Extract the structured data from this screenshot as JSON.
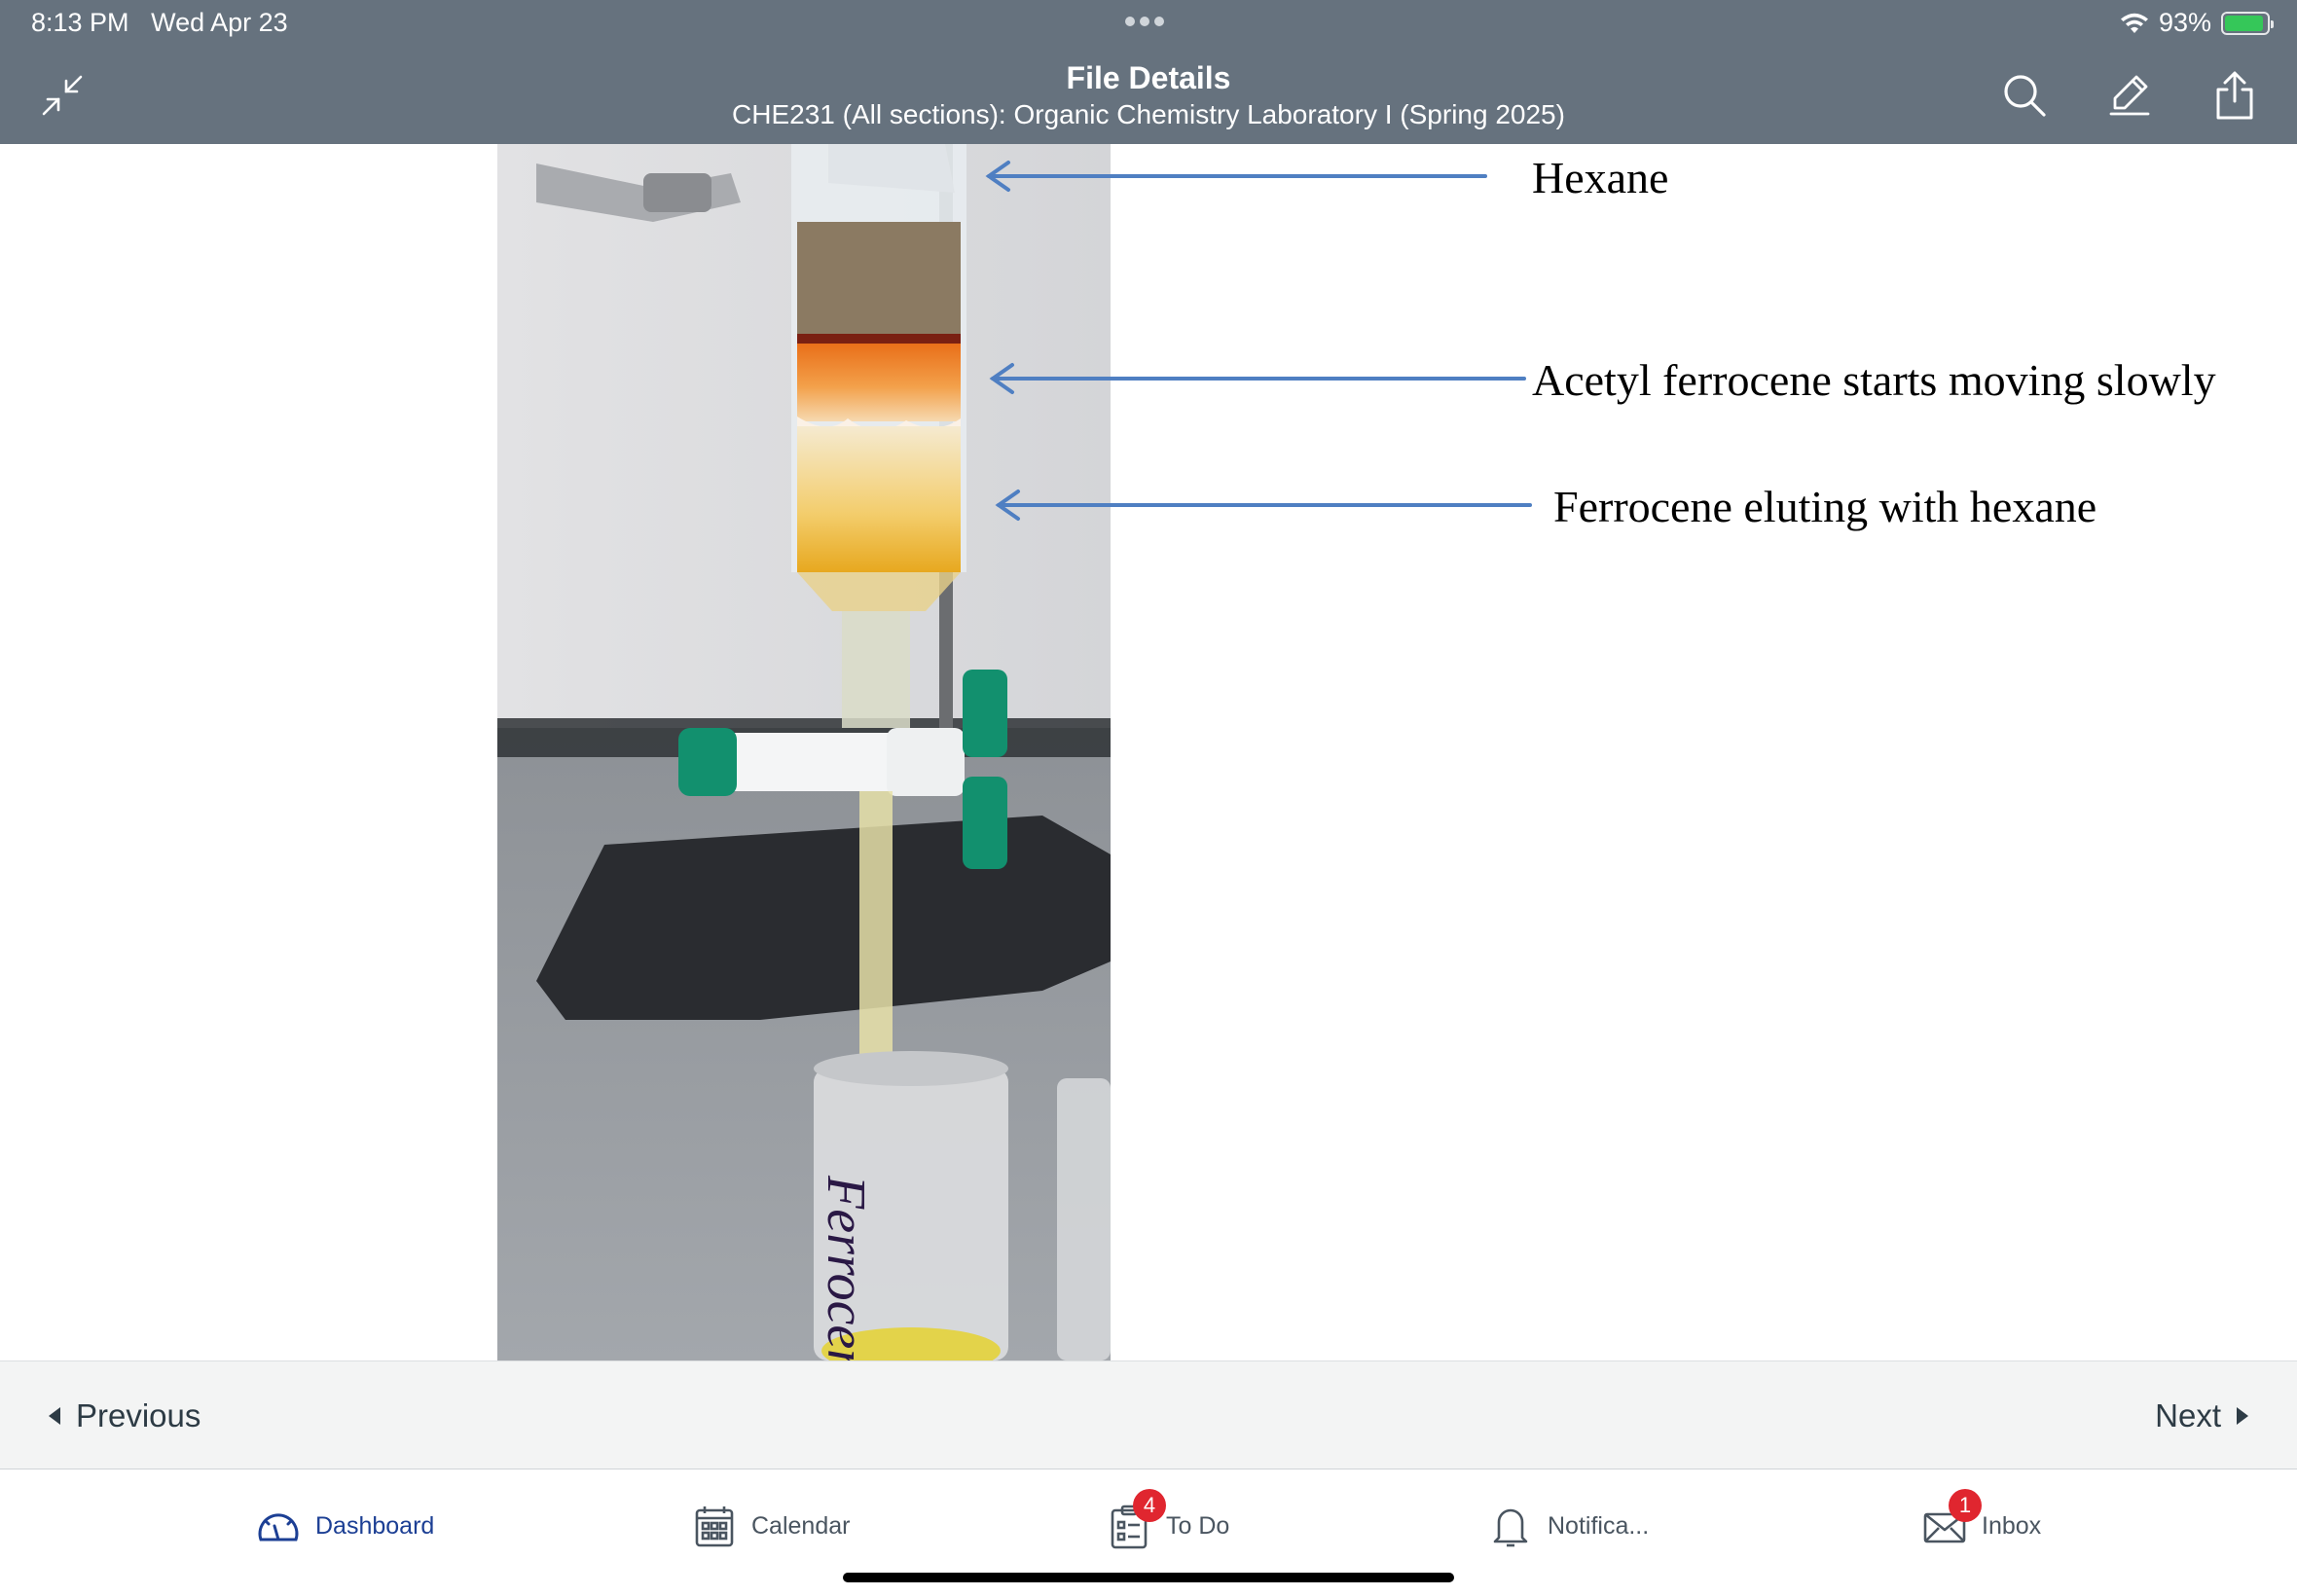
{
  "status_bar": {
    "time": "8:13 PM",
    "date": "Wed Apr 23",
    "battery": "93%",
    "battery_level": 0.93
  },
  "header": {
    "title": "File Details",
    "subtitle": "CHE231 (All sections): Organic Chemistry Laboratory I (Spring 2025)",
    "left_icon": "collapse-icon",
    "right_icons": [
      "search-icon",
      "highlighter-icon",
      "share-icon"
    ]
  },
  "document": {
    "annotations": [
      {
        "label": "Hexane"
      },
      {
        "label": "Acetyl ferrocene starts moving slowly"
      },
      {
        "label": "Ferrocene eluting with hexane"
      }
    ],
    "vial_label": "Ferrocene",
    "arrow_color": "#4f7fc2"
  },
  "pager": {
    "previous_label": "Previous",
    "next_label": "Next"
  },
  "tabbar": {
    "items": [
      {
        "label": "Dashboard",
        "icon": "dashboard-icon",
        "active": true
      },
      {
        "label": "Calendar",
        "icon": "calendar-icon"
      },
      {
        "label": "To Do",
        "icon": "todo-icon",
        "badge": "4"
      },
      {
        "label": "Notifica...",
        "icon": "bell-icon"
      },
      {
        "label": "Inbox",
        "icon": "inbox-icon",
        "badge": "1"
      }
    ],
    "active_color": "#1c3f94"
  },
  "colors": {
    "header_bg": "#66727e",
    "badge": "#e0262f"
  }
}
